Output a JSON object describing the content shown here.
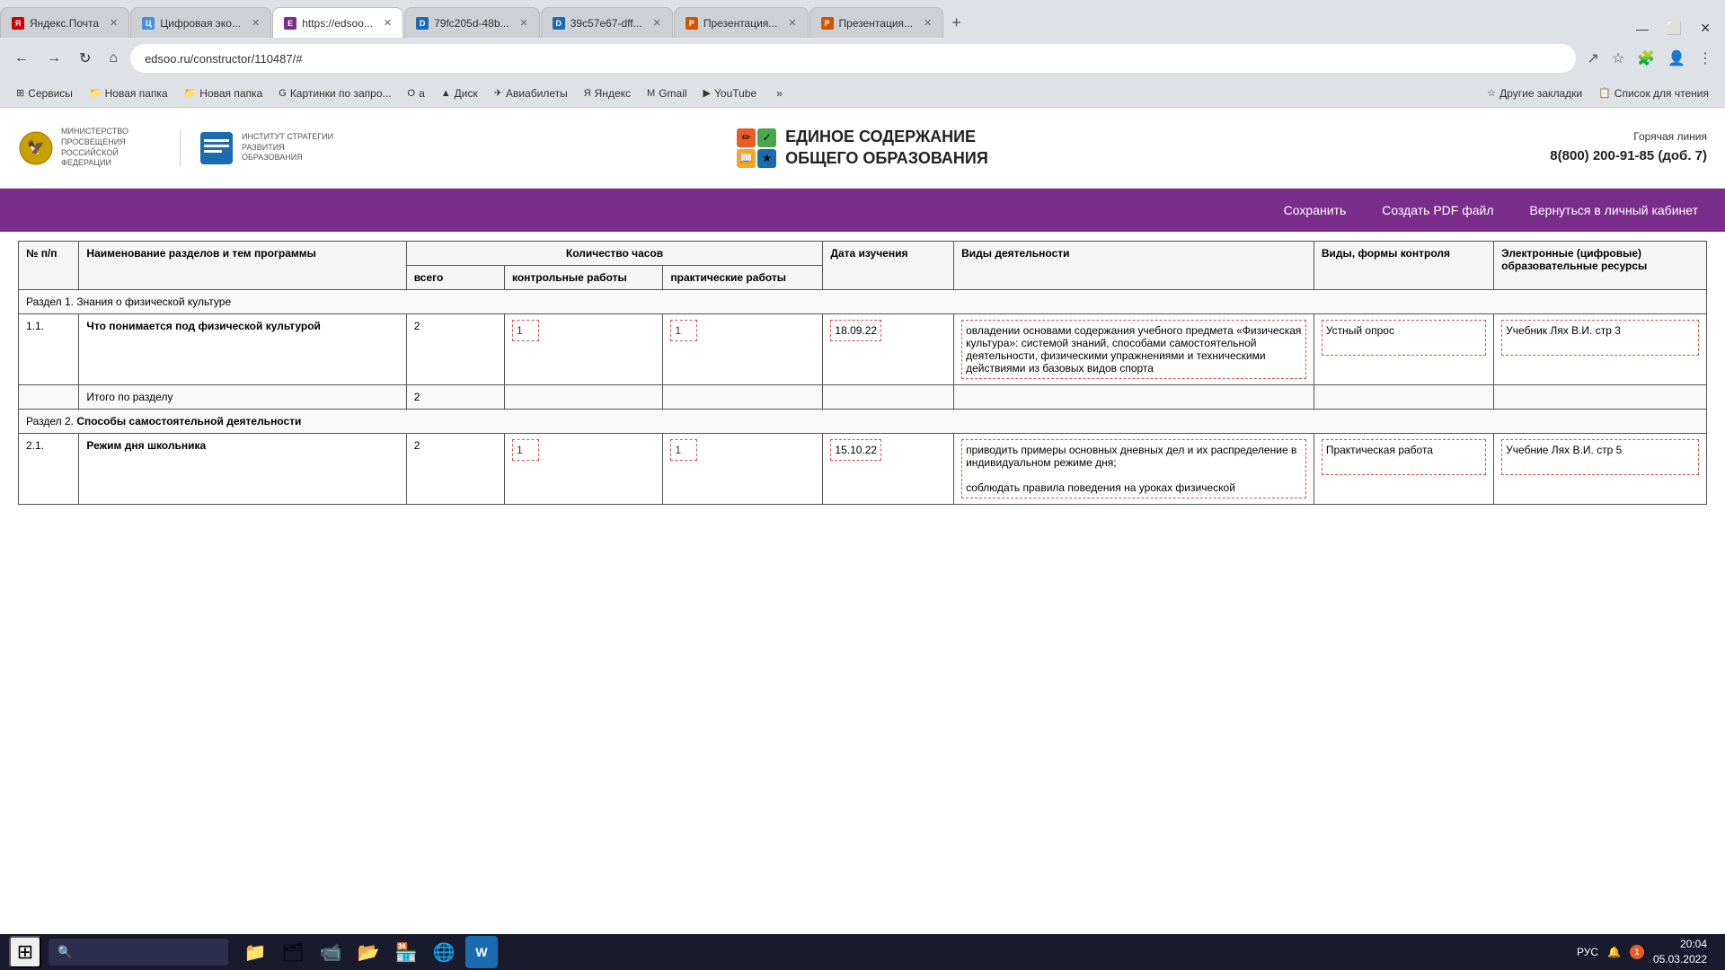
{
  "browser": {
    "tabs": [
      {
        "id": "tab1",
        "label": "Яндекс.Почта",
        "fav": "Я",
        "favType": "yandex",
        "active": false
      },
      {
        "id": "tab2",
        "label": "Цифровая эко...",
        "fav": "Ц",
        "favType": "digit",
        "active": false
      },
      {
        "id": "tab3",
        "label": "https://edsoo...",
        "fav": "E",
        "favType": "edsoo",
        "active": true
      },
      {
        "id": "tab4",
        "label": "79fc205d-48b...",
        "fav": "D",
        "favType": "doc",
        "active": false
      },
      {
        "id": "tab5",
        "label": "39c57e67-dff...",
        "fav": "D",
        "favType": "doc",
        "active": false
      },
      {
        "id": "tab6",
        "label": "Презентация...",
        "fav": "P",
        "favType": "pres",
        "active": false
      },
      {
        "id": "tab7",
        "label": "Презентация...",
        "fav": "P",
        "favType": "pres",
        "active": false
      }
    ],
    "address": "edsoo.ru/constructor/110487/#",
    "bookmarks": [
      {
        "label": "Сервисы",
        "icon": "⊞"
      },
      {
        "label": "Новая папка",
        "icon": "📁"
      },
      {
        "label": "Новая папка",
        "icon": "📁"
      },
      {
        "label": "Картинки по запро...",
        "icon": "G"
      },
      {
        "label": "a",
        "icon": "О"
      },
      {
        "label": "Диск",
        "icon": "▲"
      },
      {
        "label": "Авиабилеты",
        "icon": "✈"
      },
      {
        "label": "Яндекс",
        "icon": "Я"
      },
      {
        "label": "Gmail",
        "icon": "M"
      },
      {
        "label": "YouTube",
        "icon": "▶"
      },
      {
        "label": "»",
        "icon": ""
      },
      {
        "label": "Другие закладки",
        "icon": "☆"
      },
      {
        "label": "Список для чтения",
        "icon": "📋"
      }
    ]
  },
  "site": {
    "logo_left1": "МИНИСТЕРСТВО ПРОСВЕЩЕНИЯ РОССИЙСКОЙ ФЕДЕРАЦИИ",
    "logo_left2": "ИНСТИТУТ СТРАТЕГИИ РАЗВИТИЯ ОБРАЗОВАНИЯ",
    "logo_center_line1": "ЕДИНОЕ СОДЕРЖАНИЕ",
    "logo_center_line2": "ОБЩЕГО ОБРАЗОВАНИЯ",
    "hotline_label": "Горячая линия",
    "hotline_number": "8(800) 200-91-85 (доб. 7)"
  },
  "toolbar": {
    "save": "Сохранить",
    "pdf": "Создать PDF файл",
    "cabinet": "Вернуться в личный кабинет"
  },
  "table": {
    "headers": {
      "num": "№ п/п",
      "name": "Наименование разделов и тем программы",
      "hours_group": "Количество часов",
      "hours_total": "всего",
      "hours_control": "контрольные работы",
      "hours_practice": "практические работы",
      "date": "Дата изучения",
      "activity": "Виды деятельности",
      "forms": "Виды, формы контроля",
      "resources": "Электронные (цифровые) образовательные ресурсы"
    },
    "rows": [
      {
        "type": "section",
        "label": "Раздел 1. Знания о физической культуре",
        "bold": false
      },
      {
        "type": "data",
        "num": "1.1.",
        "name": "Что понимается под физической культурой",
        "hours_total": "2",
        "hours_control": "1",
        "hours_practice": "1",
        "date": "18.09.22",
        "activity": "овладении основами содержания учебного предмета «Физическая культура»: системой знаний, способами самостоятельной деятельности, физическими упражнениями и техническими действиями из базовых видов спорта",
        "forms": "Устный опрос",
        "resources": "Учебник Лях В.И. стр 3"
      },
      {
        "type": "total",
        "label": "Итого по разделу",
        "hours_total": "2"
      },
      {
        "type": "section",
        "label": "Раздел 2. Способы самостоятельной деятельности",
        "bold": true
      },
      {
        "type": "data",
        "num": "2.1.",
        "name": "Режим дня школьника",
        "hours_total": "2",
        "hours_control": "1",
        "hours_practice": "1",
        "date": "15.10.22",
        "activity": "приводить примеры основных дневных дел и их распределение в индивидуальном режиме дня;\n\nсоблюдать правила поведения на уроках физической",
        "forms": "Практическая работа",
        "resources": "Учебние Лях В.И. стр 5"
      }
    ]
  },
  "taskbar": {
    "apps": [
      {
        "icon": "⊞",
        "label": "Start"
      },
      {
        "icon": "🔍",
        "label": "Search"
      },
      {
        "icon": "📁",
        "label": "File Explorer"
      },
      {
        "icon": "🗂",
        "label": "Widget"
      },
      {
        "icon": "📹",
        "label": "Camera"
      },
      {
        "icon": "📂",
        "label": "Files"
      },
      {
        "icon": "🏪",
        "label": "Store"
      },
      {
        "icon": "🌐",
        "label": "Edge"
      },
      {
        "icon": "W",
        "label": "Word"
      }
    ],
    "time": "20:04",
    "date": "05.03.2022",
    "lang": "РУС",
    "notification_count": "1"
  }
}
